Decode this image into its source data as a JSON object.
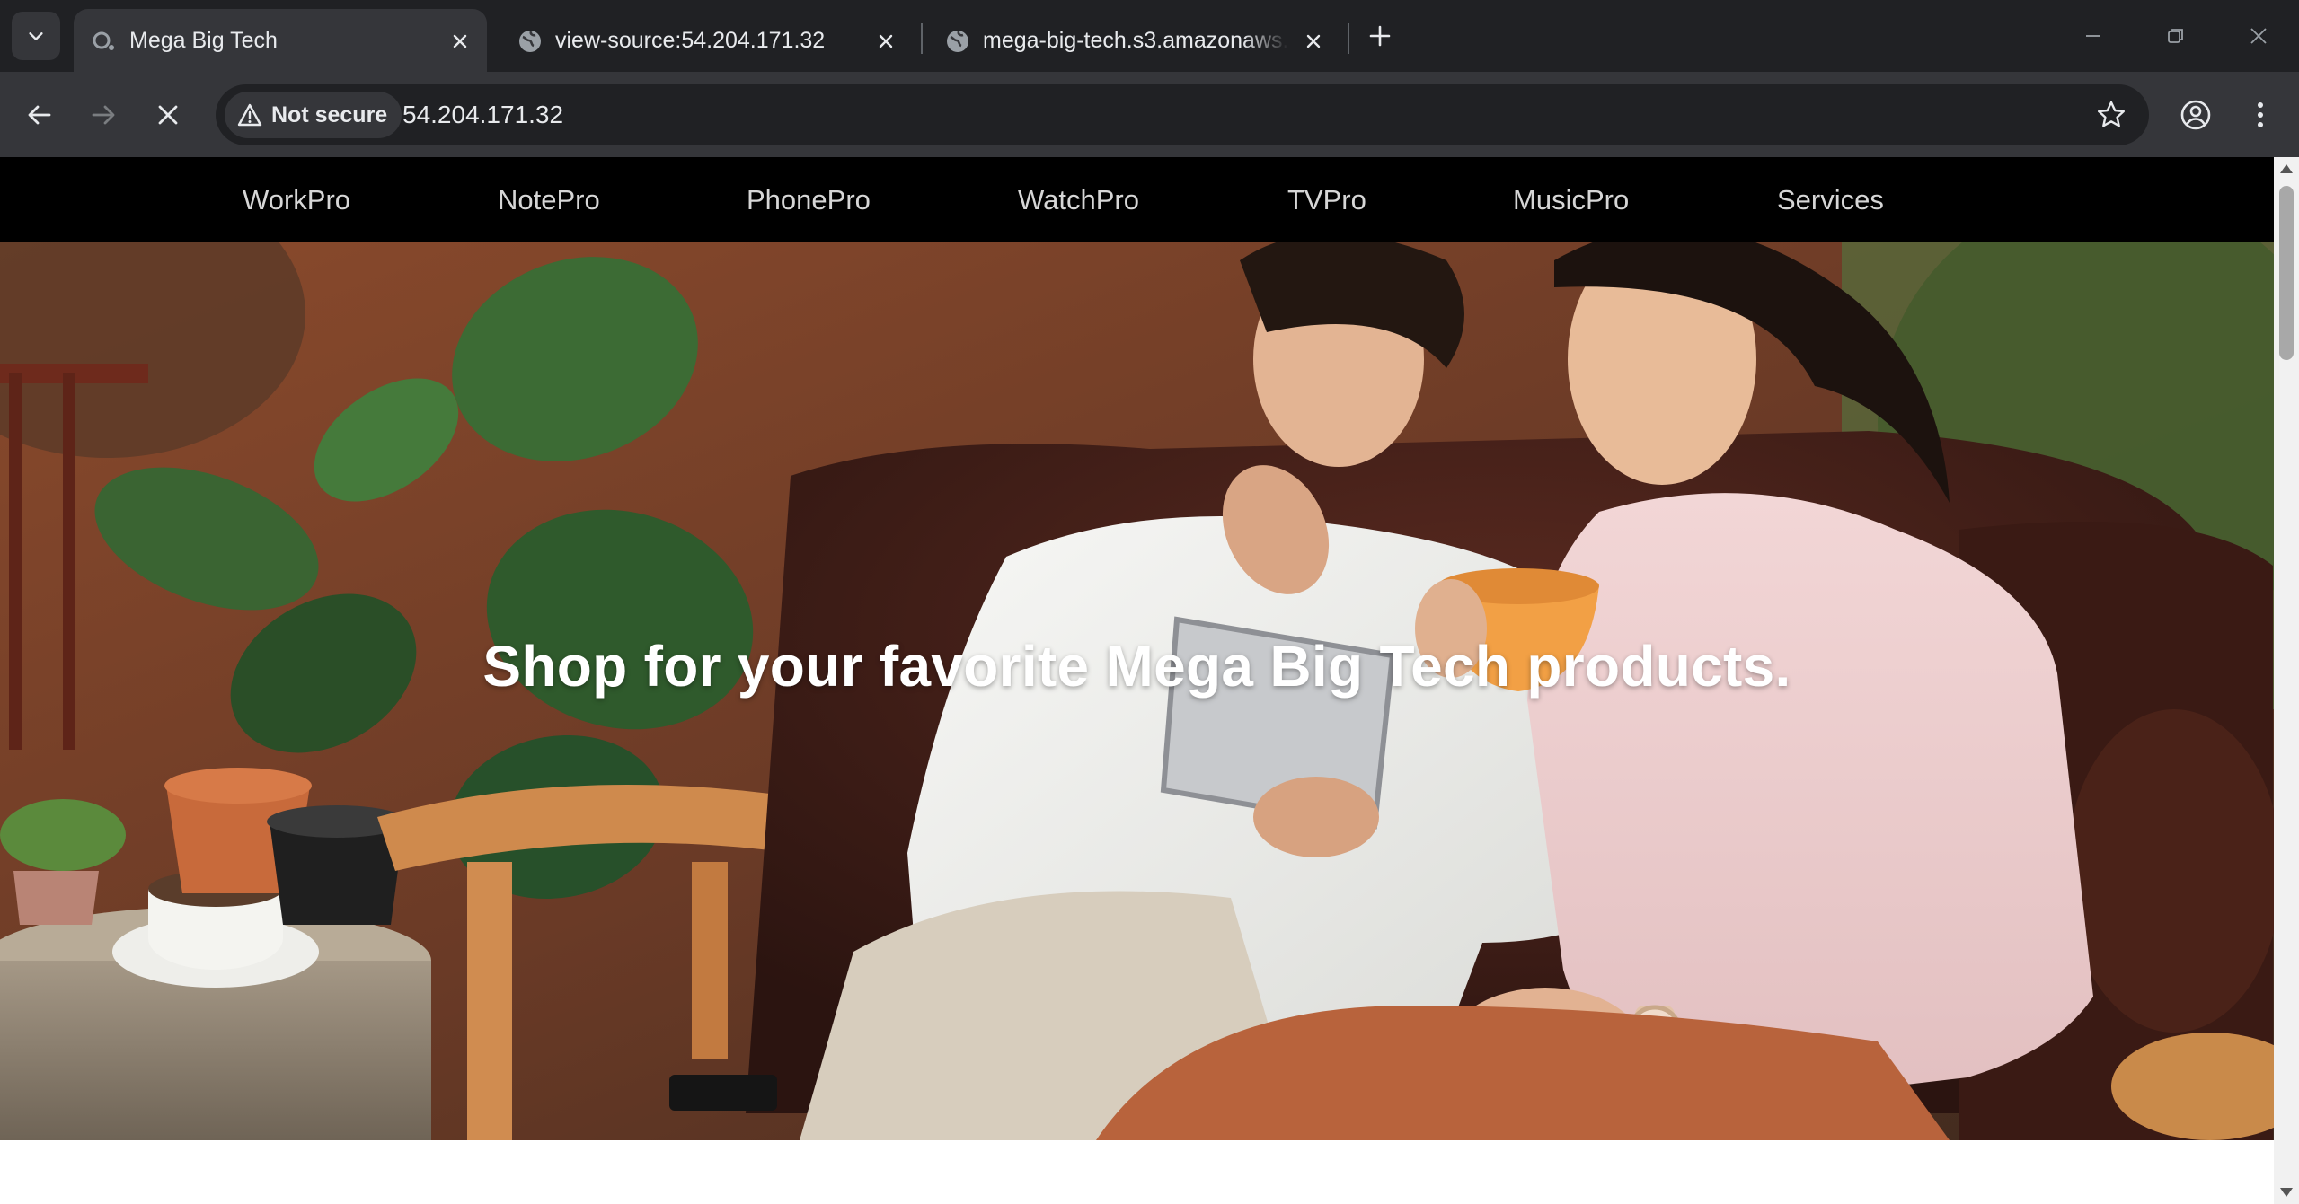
{
  "browser": {
    "tabs": [
      {
        "title": "Mega Big Tech",
        "active": true,
        "icon": "loading-globe-icon"
      },
      {
        "title": "view-source:54.204.171.32",
        "active": false,
        "icon": "globe-icon"
      },
      {
        "title": "mega-big-tech.s3.amazonaws.c",
        "active": false,
        "icon": "globe-icon"
      }
    ],
    "security_chip": "Not secure",
    "url": "54.204.171.32"
  },
  "site": {
    "nav": [
      "WorkPro",
      "NotePro",
      "PhonePro",
      "WatchPro",
      "TVPro",
      "MusicPro",
      "Services"
    ],
    "hero_text": "Shop for your favorite Mega Big Tech products."
  },
  "colors": {
    "browser_bg": "#202124",
    "toolbar_bg": "#35363a",
    "nav_bg": "#000000",
    "nav_text": "#d6d6d6",
    "hero_text": "#ffffff"
  }
}
